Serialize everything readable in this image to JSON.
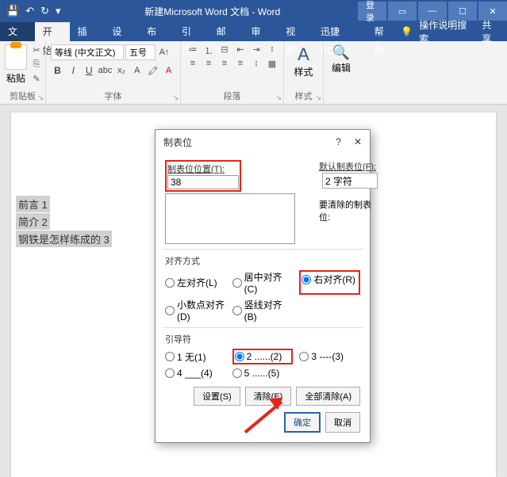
{
  "titlebar": {
    "title": "新建Microsoft Word 文档 - Word",
    "login": "登录"
  },
  "menu": {
    "file": "文件",
    "home": "开始",
    "insert": "插入",
    "design": "设计",
    "layout": "布局",
    "references": "引用",
    "mailings": "邮件",
    "review": "审阅",
    "view": "视图",
    "xunjie": "迅捷PDF",
    "help": "帮助",
    "tell_me": "操作说明搜索",
    "share": "共享"
  },
  "ribbon": {
    "clipboard": {
      "label": "剪贴板",
      "paste": "粘贴"
    },
    "font": {
      "label": "字体",
      "name": "等线 (中文正文)",
      "size": "五号"
    },
    "paragraph": {
      "label": "段落"
    },
    "styles": {
      "label": "样式",
      "btn": "样式"
    },
    "editing": {
      "label": "编辑",
      "btn": "编辑"
    }
  },
  "document": {
    "lines": [
      "前言 1",
      "简介 2",
      "钢铁是怎样练成的 3"
    ]
  },
  "dialog": {
    "title": "制表位",
    "position_label": "制表位位置(T):",
    "position_value": "38",
    "default_label": "默认制表位(F):",
    "default_value": "2 字符",
    "clear_label": "要清除的制表位:",
    "align_label": "对齐方式",
    "align": {
      "left": "左对齐(L)",
      "center": "居中对齐(C)",
      "right": "右对齐(R)",
      "decimal": "小数点对齐(D)",
      "bar": "竖线对齐(B)"
    },
    "align_selected": "right",
    "leader_label": "引导符",
    "leader": {
      "none": "1 无(1)",
      "dots": "2 ......(2)",
      "dashes": "3 ----(3)",
      "under": "4 ___(4)",
      "dots2": "5 ......(5)"
    },
    "leader_selected": "dots",
    "buttons": {
      "set": "设置(S)",
      "clear": "清除(E)",
      "clear_all": "全部清除(A)",
      "ok": "确定",
      "cancel": "取消"
    }
  }
}
